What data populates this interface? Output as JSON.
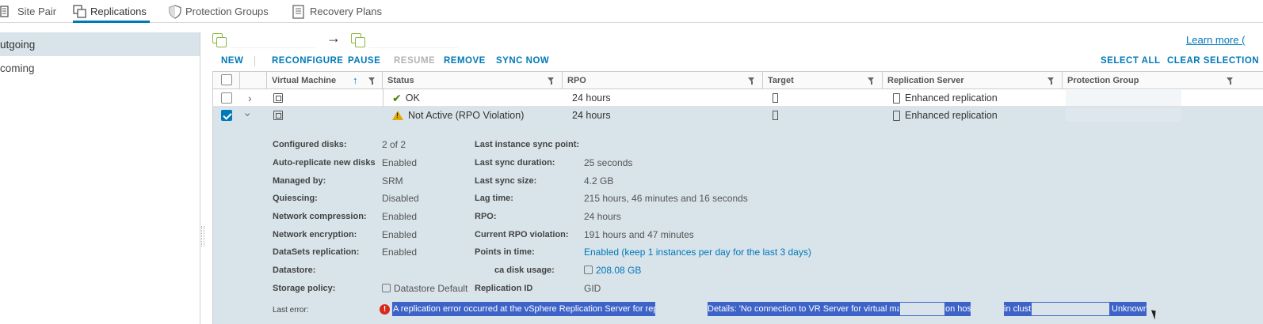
{
  "tabs": [
    {
      "label": "Site Pair",
      "icon": "building-icon"
    },
    {
      "label": "Replications",
      "icon": "replications-icon",
      "active": true
    },
    {
      "label": "Protection Groups",
      "icon": "shield-icon"
    },
    {
      "label": "Recovery Plans",
      "icon": "document-icon"
    }
  ],
  "nav": {
    "outgoing": "utgoing",
    "incoming": "coming"
  },
  "header": {
    "arrow": "→",
    "learn_more": "Learn more ("
  },
  "toolbar": {
    "new": "NEW",
    "reconfigure": "RECONFIGURE",
    "pause": "PAUSE",
    "resume": "RESUME",
    "remove": "REMOVE",
    "sync_now": "SYNC NOW",
    "select_all": "SELECT ALL",
    "clear_selection": "CLEAR SELECTION"
  },
  "columns": {
    "vm": "Virtual Machine",
    "status": "Status",
    "rpo": "RPO",
    "target": "Target",
    "server": "Replication Server",
    "group": "Protection Group"
  },
  "rows": [
    {
      "status": "OK",
      "status_kind": "ok",
      "rpo": "24 hours",
      "server": "Enhanced replication",
      "checked": false,
      "expanded": false
    },
    {
      "status": "Not Active (RPO Violation)",
      "status_kind": "warning",
      "rpo": "24 hours",
      "server": "Enhanced replication",
      "checked": true,
      "expanded": true
    }
  ],
  "details": {
    "configured_disks": {
      "label": "Configured disks:",
      "value": "2 of 2"
    },
    "auto_replicate": {
      "label": "Auto-replicate new disks",
      "value": "Enabled"
    },
    "managed_by": {
      "label": "Managed by:",
      "value": "SRM"
    },
    "quiescing": {
      "label": "Quiescing:",
      "value": "Disabled"
    },
    "net_compression": {
      "label": "Network compression:",
      "value": "Enabled"
    },
    "net_encryption": {
      "label": "Network encryption:",
      "value": "Enabled"
    },
    "datasets": {
      "label": "DataSets replication:",
      "value": "Enabled"
    },
    "datastore": {
      "label": "Datastore:",
      "value": ""
    },
    "storage_policy": {
      "label": "Storage policy:",
      "value": "Datastore Default"
    },
    "last_error": {
      "label": "Last error:"
    },
    "last_instance_sync": {
      "label": "Last instance sync point:",
      "value": ""
    },
    "last_sync_duration": {
      "label": "Last sync duration:",
      "value": "25 seconds"
    },
    "last_sync_size": {
      "label": "Last sync size:",
      "value": "4.2 GB"
    },
    "lag_time": {
      "label": "Lag time:",
      "value": "215 hours, 46 minutes and 16 seconds"
    },
    "rpo": {
      "label": "RPO:",
      "value": "24 hours"
    },
    "current_rpo_violation": {
      "label": "Current RPO violation:",
      "value": "191 hours and 47 minutes"
    },
    "points_in_time": {
      "label": "Points in time:",
      "value": "Enabled (keep 1 instances per day for the last 3 days)"
    },
    "disk_usage": {
      "label": "ca disk usage:",
      "value": "208.08 GB"
    },
    "replication_id": {
      "label": "Replication ID",
      "value": "GID"
    }
  },
  "error": {
    "part1": "A replication error occurred at the vSphere Replication Server for replication",
    "part2": "Details: 'No connection to VR Server for virtual machine",
    "part3": "on host",
    "part4": "in cluste",
    "part5": "Unknown'"
  },
  "colors": {
    "accent": "#0079b8",
    "selected_row": "#d8e3ea",
    "ok": "#3c8500",
    "warning": "#e5a800",
    "error": "#d9281c",
    "text_highlight": "#3e63c8"
  }
}
